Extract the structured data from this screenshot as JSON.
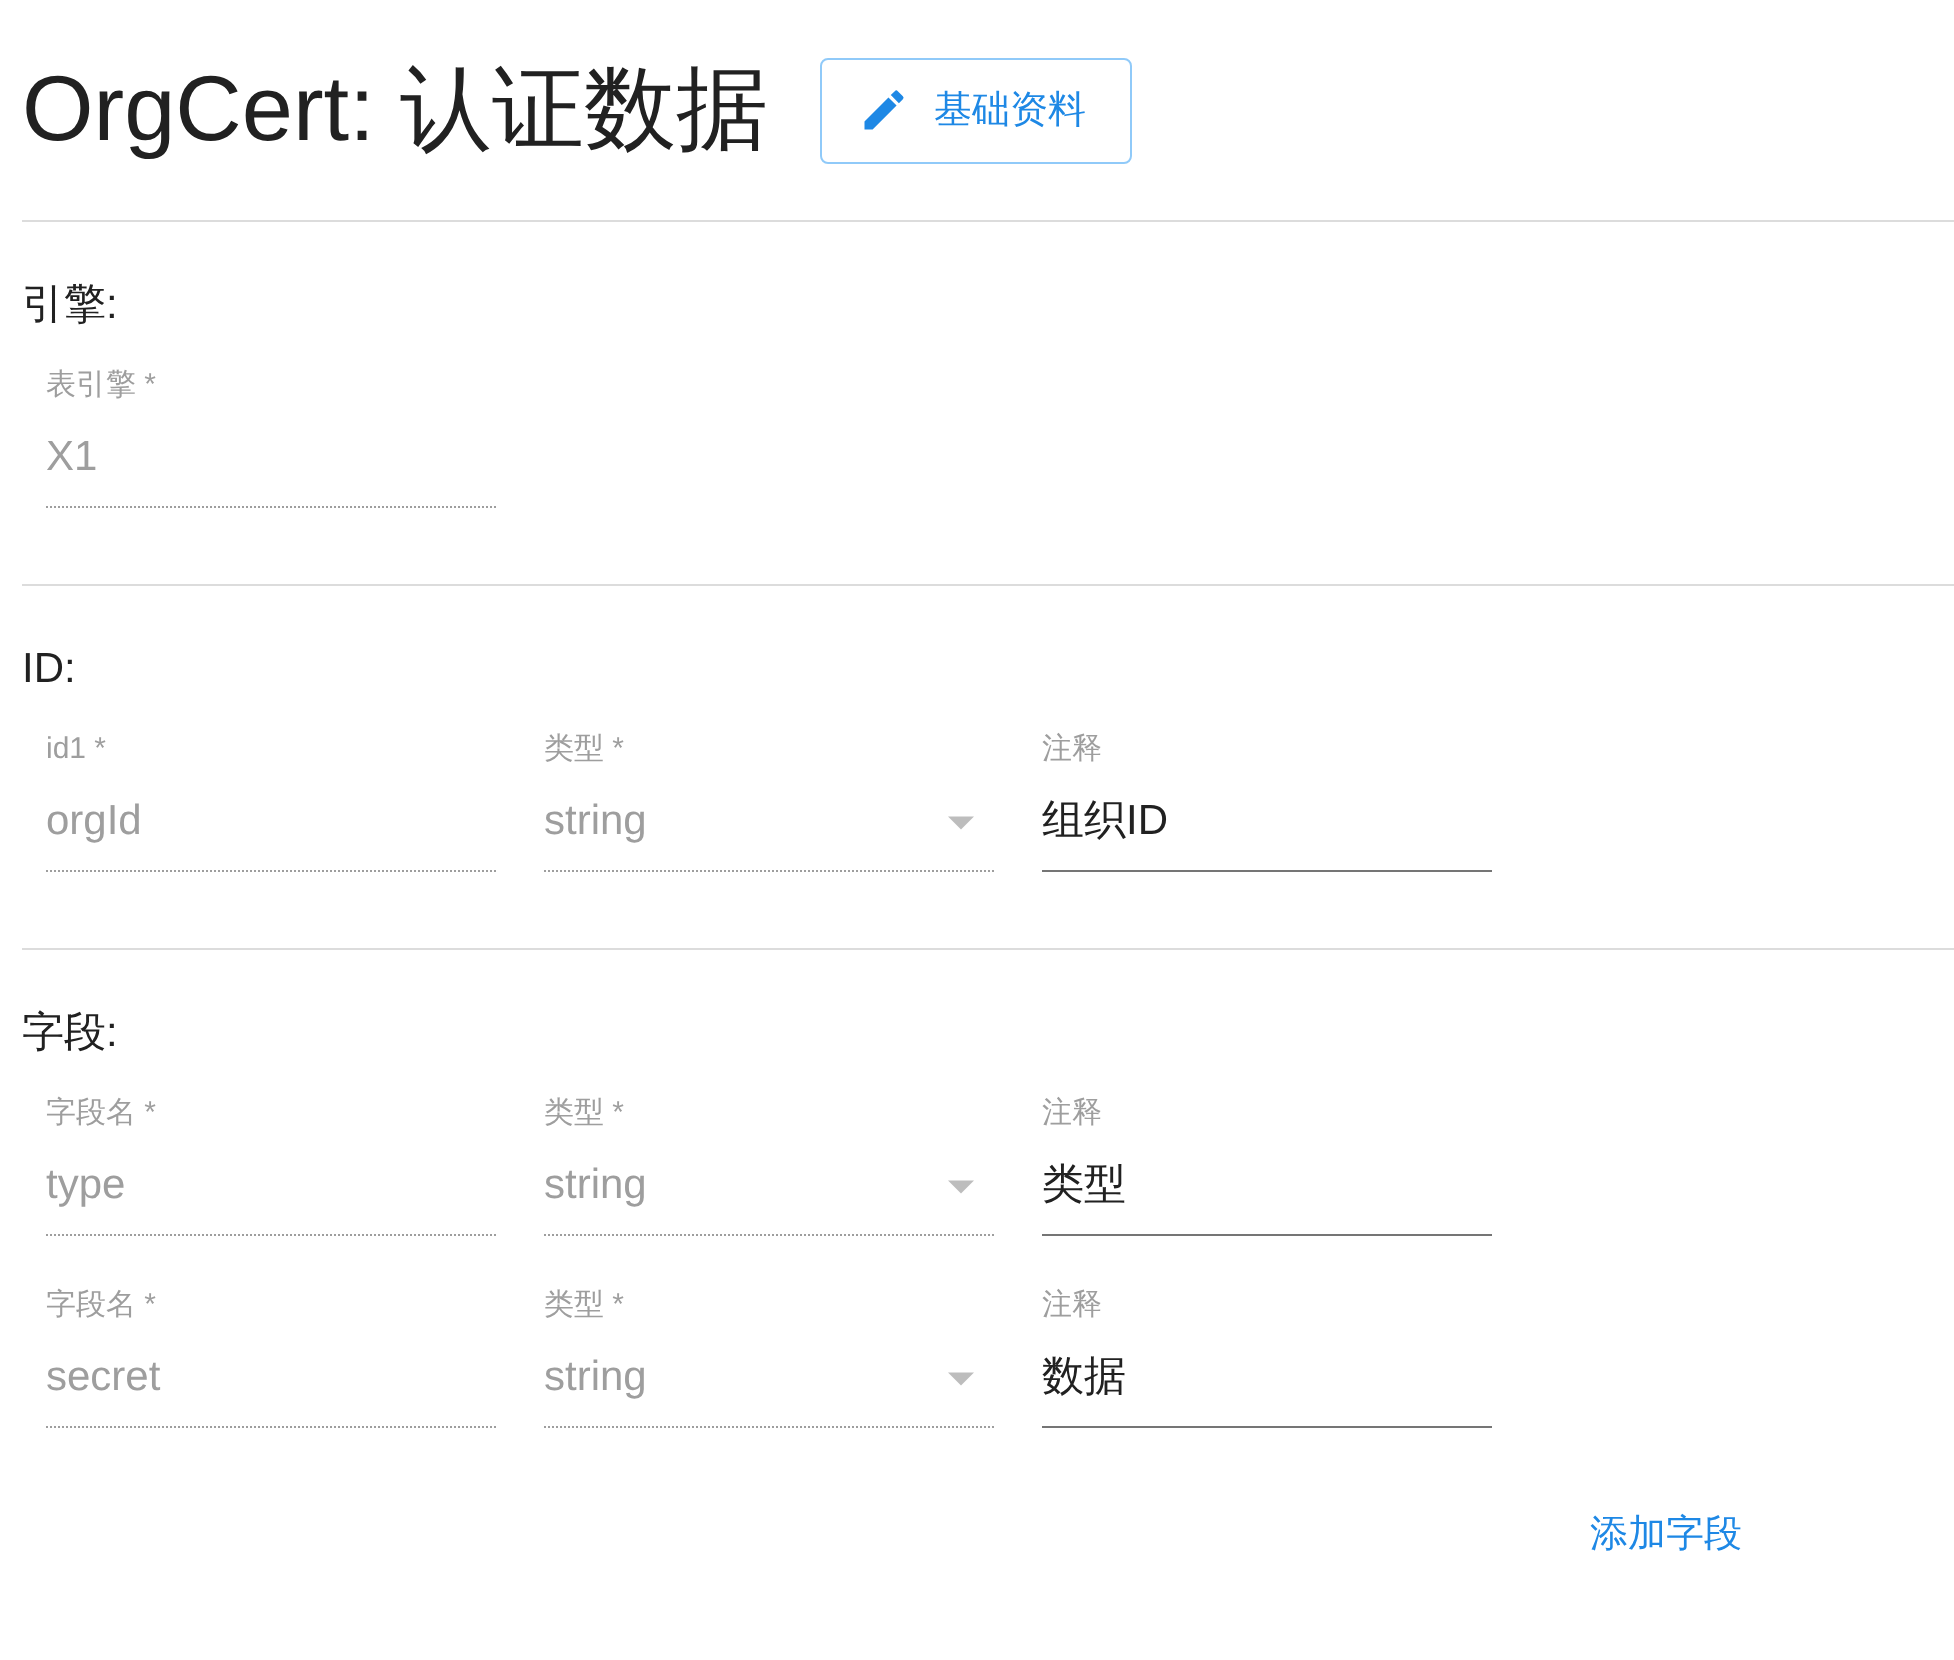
{
  "title": "OrgCert: 认证数据",
  "edit_button": {
    "label": "基础资料"
  },
  "sections": [
    {
      "heading": "引擎:",
      "rows": [
        [
          {
            "kind": "text",
            "label": "表引擎 *",
            "value": "X1",
            "disabled": true
          }
        ]
      ]
    },
    {
      "heading": "ID:",
      "rows": [
        [
          {
            "kind": "text",
            "label": "id1 *",
            "value": "orgId",
            "disabled": true
          },
          {
            "kind": "select",
            "label": "类型 *",
            "value": "string",
            "disabled": true
          },
          {
            "kind": "text",
            "label": "注释",
            "value": "组织ID",
            "disabled": false
          }
        ]
      ]
    },
    {
      "heading": "字段:",
      "rows": [
        [
          {
            "kind": "text",
            "label": "字段名 *",
            "value": "type",
            "disabled": true
          },
          {
            "kind": "select",
            "label": "类型 *",
            "value": "string",
            "disabled": true
          },
          {
            "kind": "text",
            "label": "注释",
            "value": "类型",
            "disabled": false
          }
        ],
        [
          {
            "kind": "text",
            "label": "字段名 *",
            "value": "secret",
            "disabled": true
          },
          {
            "kind": "select",
            "label": "类型 *",
            "value": "string",
            "disabled": true
          },
          {
            "kind": "text",
            "label": "注释",
            "value": "数据",
            "disabled": false
          }
        ]
      ]
    }
  ],
  "add_button": {
    "label": "添加字段"
  }
}
